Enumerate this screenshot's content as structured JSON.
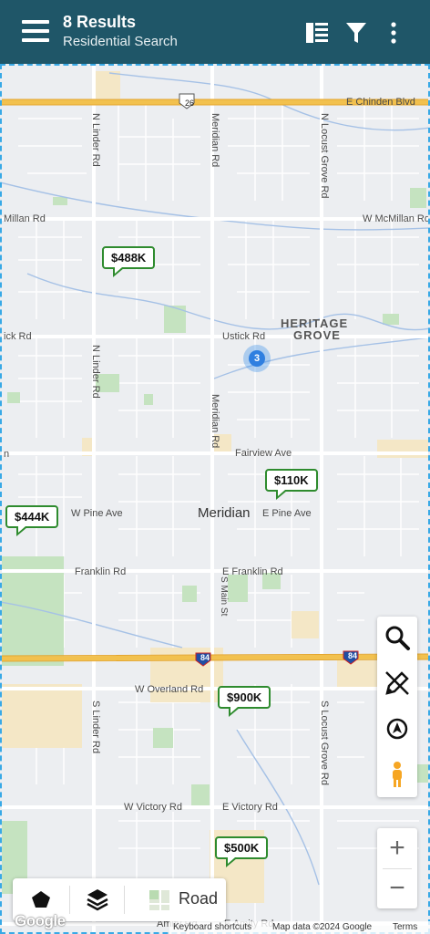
{
  "header": {
    "results": "8 Results",
    "search_name": "Residential Search",
    "icons": [
      "menu-icon",
      "list-view-icon",
      "filter-icon",
      "more-vert-icon"
    ]
  },
  "map": {
    "roads": {
      "chinden": "E Chinden Blvd",
      "highway26": "26",
      "linder_n1": "N Linder Rd",
      "meridian_n": "Meridian Rd",
      "locust_n": "N Locust Grove Rd",
      "mcmillan_w": "Millan Rd",
      "mcmillan_e": "W McMillan Rd",
      "ustick_w": "ick Rd",
      "ustick_e": "Ustick Rd",
      "linder_n2": "N Linder Rd",
      "meridian_mid": "Meridian Rd",
      "fairview": "Fairview Ave",
      "fairview_w": "n",
      "pine_w": "W Pine Ave",
      "pine_e": "E Pine Ave",
      "franklin_w": "Franklin Rd",
      "franklin_e": "E Franklin Rd",
      "main_s": "S Main St",
      "i84_w": "84",
      "i84_e": "84",
      "overland": "W Overland Rd",
      "linder_s": "S Linder Rd",
      "locust_s": "S Locust Grove Rd",
      "victory_w": "W Victory Rd",
      "victory_e": "E Victory Rd",
      "amity": "E Amity Rd",
      "amity_w": "Amity Rd"
    },
    "city": "Meridian",
    "area_name_1": "HERITAGE",
    "area_name_2": "GROVE",
    "markers": [
      {
        "price": "$488K"
      },
      {
        "price": "$110K"
      },
      {
        "price": "$444K"
      },
      {
        "price": "$900K"
      },
      {
        "price": "$500K"
      }
    ],
    "cluster_count": "3",
    "colors": {
      "marker_border": "#2e8b2e",
      "header": "#1f5668",
      "cluster": "#2f7fe0"
    }
  },
  "tools": [
    "search-icon",
    "draw-tool-icon",
    "my-location-icon",
    "street-view-pegman-icon"
  ],
  "zoom": {
    "in": "+",
    "out": "−"
  },
  "bottom_bar": {
    "road_label": "Road",
    "icons": [
      "polygon-icon",
      "layers-icon",
      "map-type-thumbnail-icon"
    ]
  },
  "attribution": {
    "logo": "Google",
    "shortcuts": "Keyboard shortcuts",
    "data": "Map data ©2024 Google",
    "terms": "Terms"
  }
}
